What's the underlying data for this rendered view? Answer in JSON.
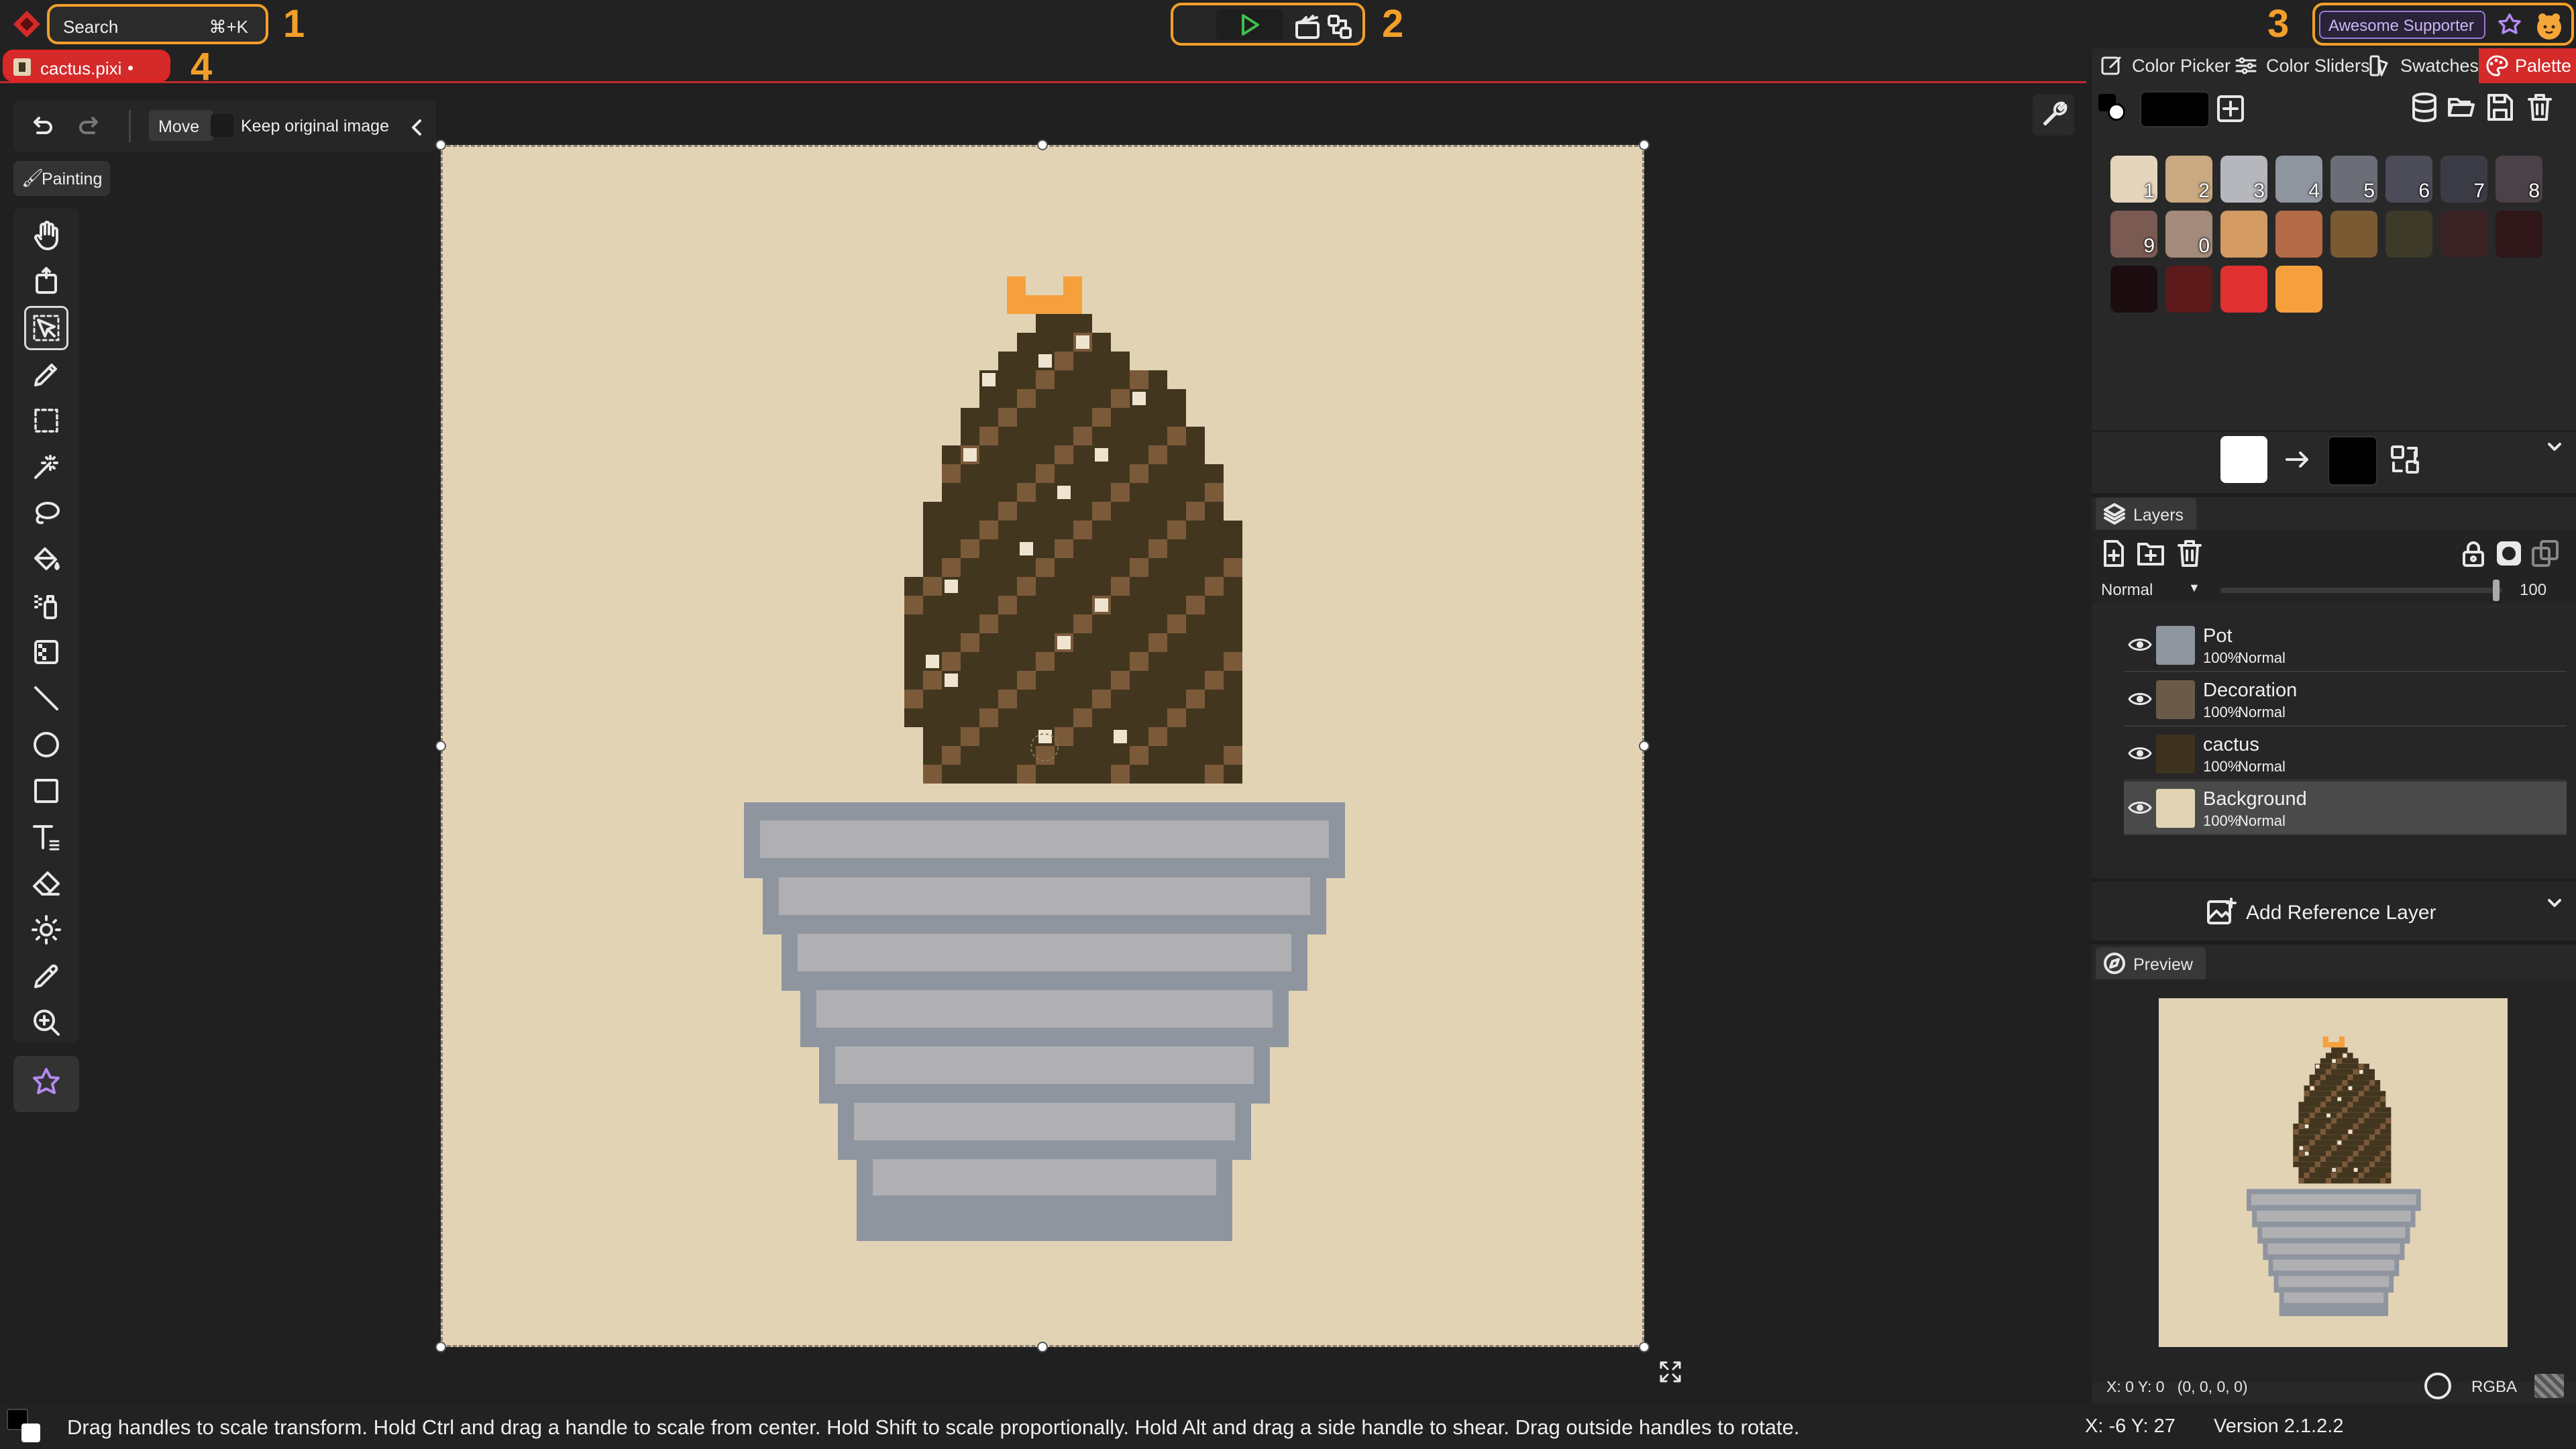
{
  "search": {
    "label": "Search",
    "shortcut": "⌘+K"
  },
  "annotations": {
    "n1": "1",
    "n2": "2",
    "n3": "3",
    "n4": "4"
  },
  "supporter_label": "Awesome Supporter",
  "file_tab": {
    "name": "cactus.pixi",
    "dot": "•"
  },
  "tool_options": {
    "move_label": "Move",
    "keep_label": "Keep original image"
  },
  "mode_badge": "Painting",
  "color_tabs": [
    {
      "label": "Color Picker",
      "icon": "color-picker-icon"
    },
    {
      "label": "Color Sliders",
      "icon": "sliders-icon"
    },
    {
      "label": "Swatches",
      "icon": "swatches-icon"
    },
    {
      "label": "Palette",
      "icon": "palette-icon"
    }
  ],
  "palette": [
    {
      "color": "#e6d5bd",
      "label": "1"
    },
    {
      "color": "#c9a882",
      "label": "2"
    },
    {
      "color": "#b5b7bd",
      "label": "3"
    },
    {
      "color": "#8f959f",
      "label": "4"
    },
    {
      "color": "#6b6d77",
      "label": "5"
    },
    {
      "color": "#4c4c58",
      "label": "6"
    },
    {
      "color": "#3a3b45",
      "label": "7"
    },
    {
      "color": "#4a4248",
      "label": "8"
    },
    {
      "color": "#7a5a52",
      "label": "9"
    },
    {
      "color": "#a48a7a",
      "label": "0"
    },
    {
      "color": "#d39a62",
      "label": ""
    },
    {
      "color": "#b36b47",
      "label": ""
    },
    {
      "color": "#7a5a32",
      "label": ""
    },
    {
      "color": "#3d3a2a",
      "label": ""
    },
    {
      "color": "#3a2225",
      "label": ""
    },
    {
      "color": "#2e1619",
      "label": ""
    },
    {
      "color": "#1c0e10",
      "label": ""
    },
    {
      "color": "#5c1a1a",
      "label": ""
    },
    {
      "color": "#e03030",
      "label": ""
    },
    {
      "color": "#f5a03c",
      "label": ""
    }
  ],
  "layers_panel": {
    "title": "Layers",
    "blend_mode": "Normal",
    "opacity": "100",
    "layers": [
      {
        "name": "Pot",
        "opacity": "100%",
        "blend": "Normal",
        "thumb": "#8f959f"
      },
      {
        "name": "Decoration",
        "opacity": "100%",
        "blend": "Normal",
        "thumb": "#6a5a48"
      },
      {
        "name": "cactus",
        "opacity": "100%",
        "blend": "Normal",
        "thumb": "#3d3220"
      },
      {
        "name": "Background",
        "opacity": "100%",
        "blend": "Normal",
        "thumb": "#e2d3b5"
      }
    ],
    "add_reference_label": "Add Reference Layer"
  },
  "preview_panel": {
    "title": "Preview",
    "coords": "X: 0 Y: 0   (0, 0, 0, 0)",
    "color_mode": "RGBA"
  },
  "status_bar": {
    "hint": "Drag handles to scale transform. Hold Ctrl and drag a handle to scale from center. Hold Shift to scale proportionally. Hold Alt and drag a side handle to shear. Drag outside handles to rotate.",
    "coords": "X: -6 Y: 27",
    "version": "Version 2.1.2.2"
  },
  "colors": {
    "accent": "#f29f2a",
    "danger": "#d42a2a",
    "canvas_bg": "#e2d3b5",
    "cactus_dark": "#43361f",
    "cactus_stripe": "#7b5a3a",
    "flower": "#f5a03c",
    "pot_light": "#b0b0b3",
    "pot_dark": "#8f959f"
  },
  "toolbar_tools": [
    "hand-tool-icon",
    "move-viewport-icon",
    "select-transform-icon",
    "pen-icon",
    "rectangle-select-icon",
    "magic-wand-icon",
    "lasso-icon",
    "bucket-fill-icon",
    "spray-icon",
    "dither-icon",
    "line-icon",
    "ellipse-icon",
    "rectangle-icon",
    "text-icon",
    "eraser-icon",
    "brightness-icon",
    "color-picker-icon",
    "zoom-icon"
  ]
}
